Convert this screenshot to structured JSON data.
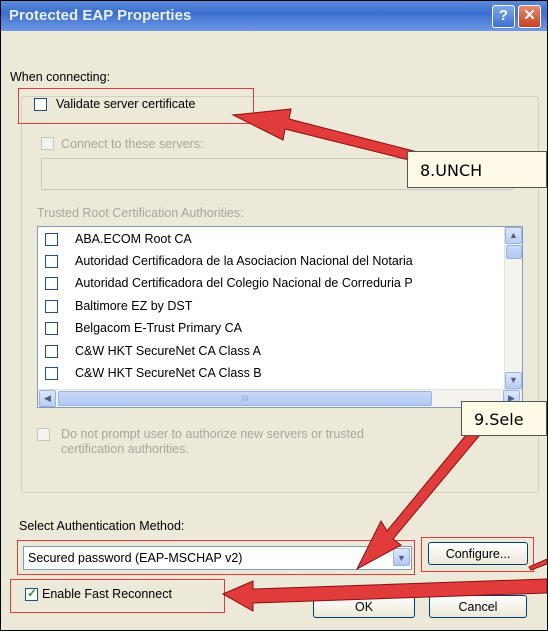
{
  "window": {
    "title": "Protected EAP Properties",
    "help_glyph": "?",
    "close_glyph": "✕"
  },
  "connecting": {
    "heading": "When connecting:",
    "validate_label": "Validate server certificate",
    "validate_checked": false,
    "connect_label": "Connect to these servers:",
    "trusted_label": "Trusted Root Certification Authorities:"
  },
  "ca_list": [
    "ABA.ECOM Root CA",
    "Autoridad Certificadora de la Asociacion Nacional del Notaria",
    "Autoridad Certificadora del Colegio Nacional de Correduria P",
    "Baltimore EZ by DST",
    "Belgacom E-Trust Primary CA",
    "C&W HKT SecureNet CA Class A",
    "C&W HKT SecureNet CA Class B"
  ],
  "scroll_glyphs": {
    "up": "▲",
    "down": "▼",
    "left": "◀",
    "right": "▶",
    "grip": "III"
  },
  "prompt": {
    "line1": "Do not prompt user to authorize new servers or trusted",
    "line2": "certification authorities."
  },
  "auth": {
    "label": "Select Authentication Method:",
    "selected": "Secured password (EAP-MSCHAP v2)",
    "configure_label": "Configure..."
  },
  "fast_reconnect": {
    "label": "Enable Fast Reconnect",
    "checked": true,
    "check_glyph": "✓"
  },
  "buttons": {
    "ok": "OK",
    "cancel": "Cancel"
  },
  "annotations": {
    "step8": "8.UNCH",
    "step9": "9.Sele",
    "accent": "#e23b3b"
  }
}
